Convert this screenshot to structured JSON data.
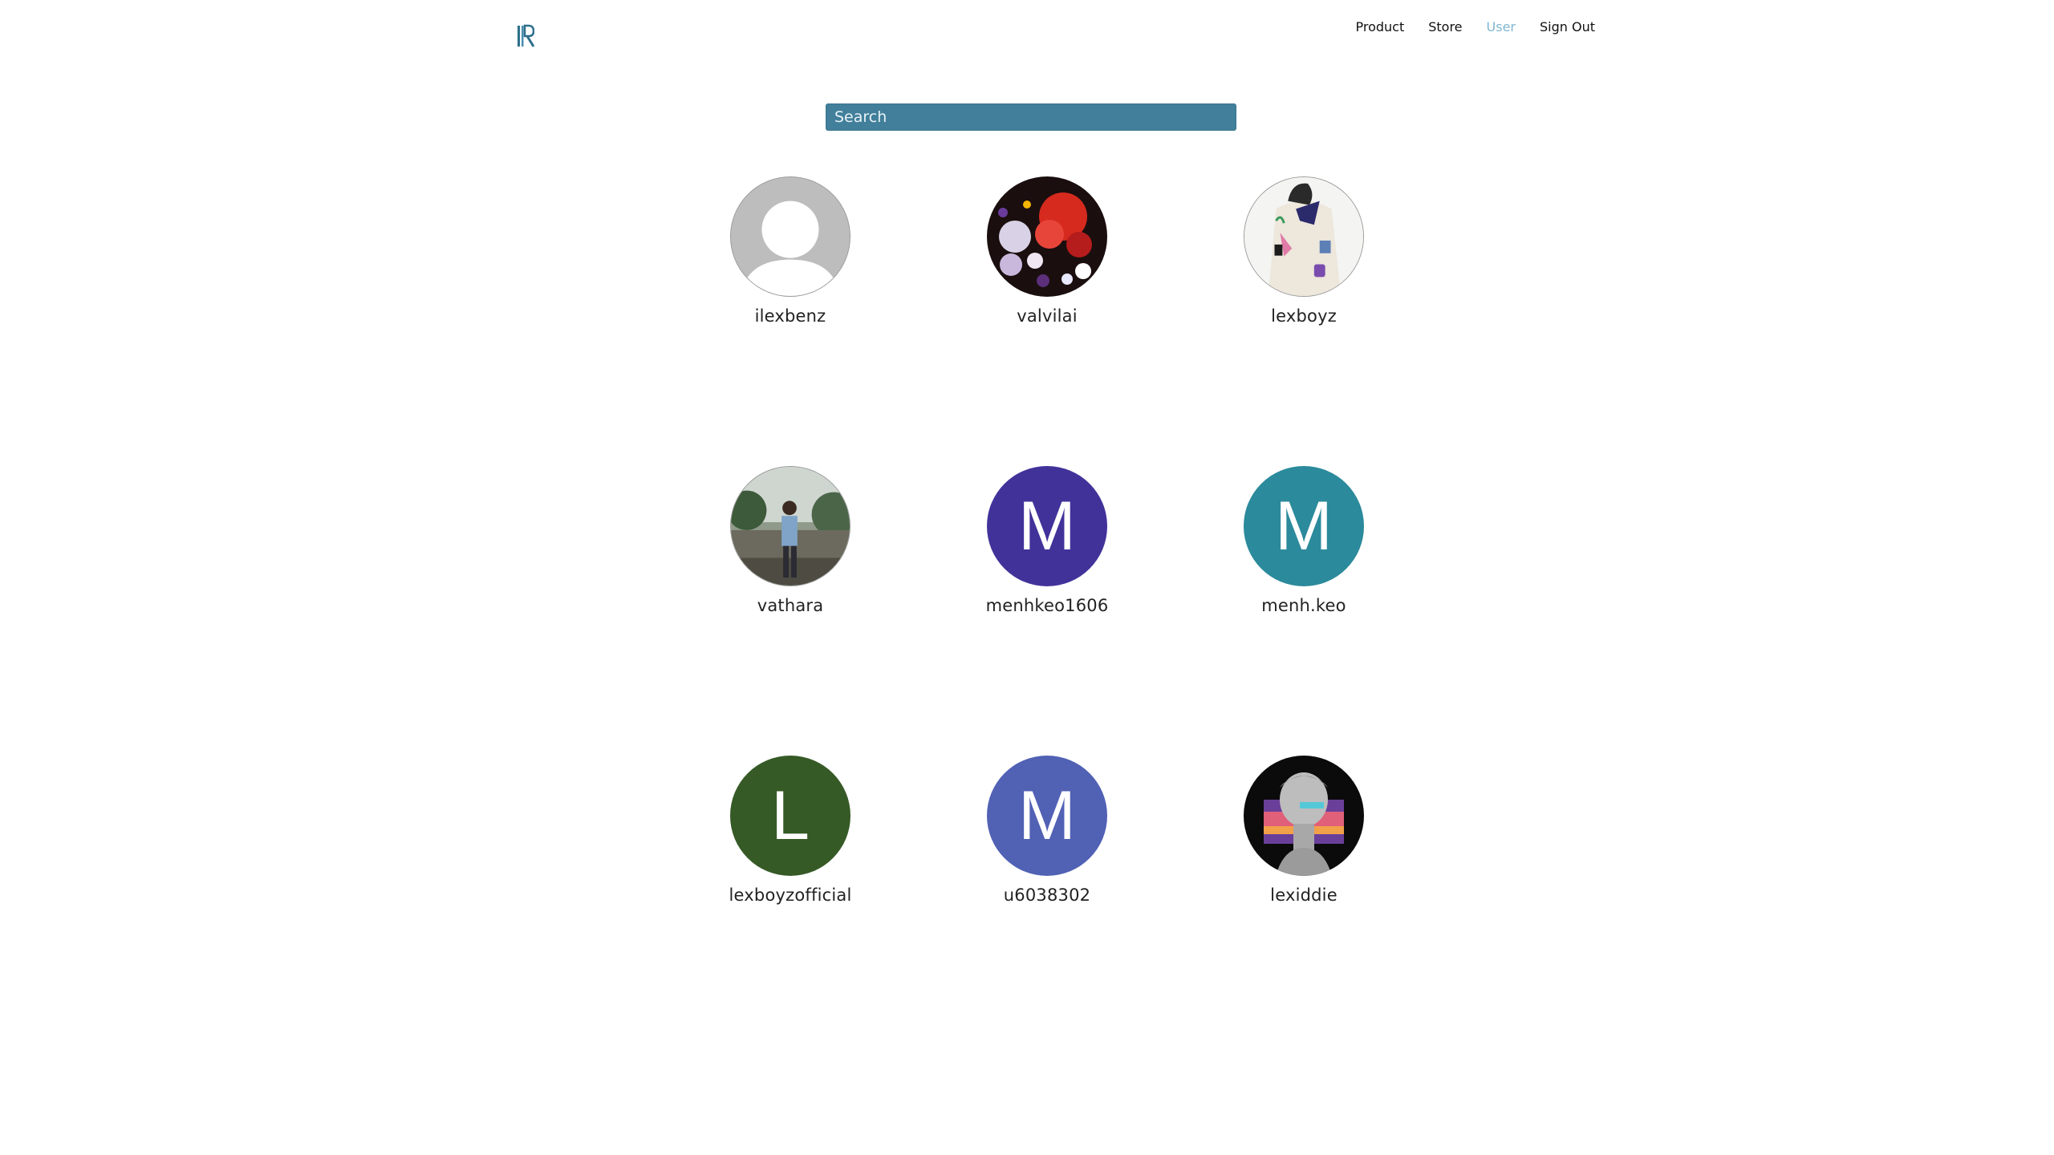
{
  "header": {
    "logo_icon": "r-logo-icon",
    "nav": [
      {
        "label": "Product",
        "active": false
      },
      {
        "label": "Store",
        "active": false
      },
      {
        "label": "User",
        "active": true
      },
      {
        "label": "Sign Out",
        "active": false
      }
    ]
  },
  "search": {
    "placeholder": "Search",
    "value": ""
  },
  "users": [
    {
      "username": "ilexbenz",
      "avatar": "default-person-icon"
    },
    {
      "username": "valvilai",
      "avatar": "photo"
    },
    {
      "username": "lexboyz",
      "avatar": "photo"
    },
    {
      "username": "vathara",
      "avatar": "photo"
    },
    {
      "username": "menhkeo1606",
      "avatar_letter": "M",
      "avatar_color": "#41329a"
    },
    {
      "username": "menh.keo",
      "avatar_letter": "M",
      "avatar_color": "#2b8a9b"
    },
    {
      "username": "lexboyzofficial",
      "avatar_letter": "L",
      "avatar_color": "#365a26"
    },
    {
      "username": "u6038302",
      "avatar_letter": "M",
      "avatar_color": "#5161b4"
    },
    {
      "username": "lexiddie",
      "avatar": "photo"
    }
  ],
  "colors": {
    "accent": "#417f9b",
    "nav_active": "#7fb6d0"
  }
}
